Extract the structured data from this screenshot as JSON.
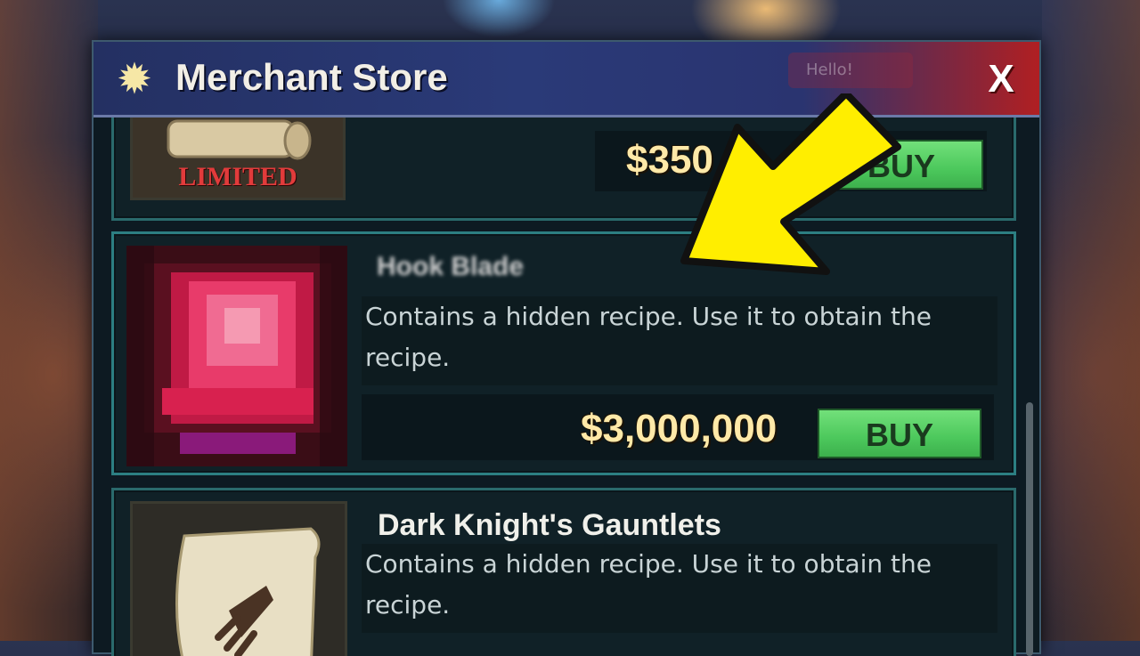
{
  "window": {
    "title": "Merchant Store",
    "close_label": "X",
    "hello_label": "Hello!"
  },
  "items": [
    {
      "name": "",
      "badge": "LIMITED",
      "price": "$350",
      "buy_label": "BUY"
    },
    {
      "name": "Hook Blade",
      "description": "Contains a hidden recipe. Use it to obtain the recipe.",
      "description_line1": "Contains a hidden recipe. Use it to obtain the",
      "description_line2": "recipe.",
      "price": "$3,000,000",
      "buy_label": "BUY"
    },
    {
      "name": "Dark Knight's Gauntlets",
      "description_line1": "Contains a hidden recipe. Use it to obtain the",
      "description_line2": "recipe."
    }
  ],
  "icons": {
    "title": "star-icon",
    "arrow": "yellow-arrow-icon"
  },
  "colors": {
    "titlebar_left": "#243062",
    "titlebar_right": "#b01f22",
    "buy_green": "#4cc85c",
    "price_gold": "#ffe9a8",
    "limited_red": "#e23b3b",
    "arrow_yellow": "#ffee00"
  }
}
